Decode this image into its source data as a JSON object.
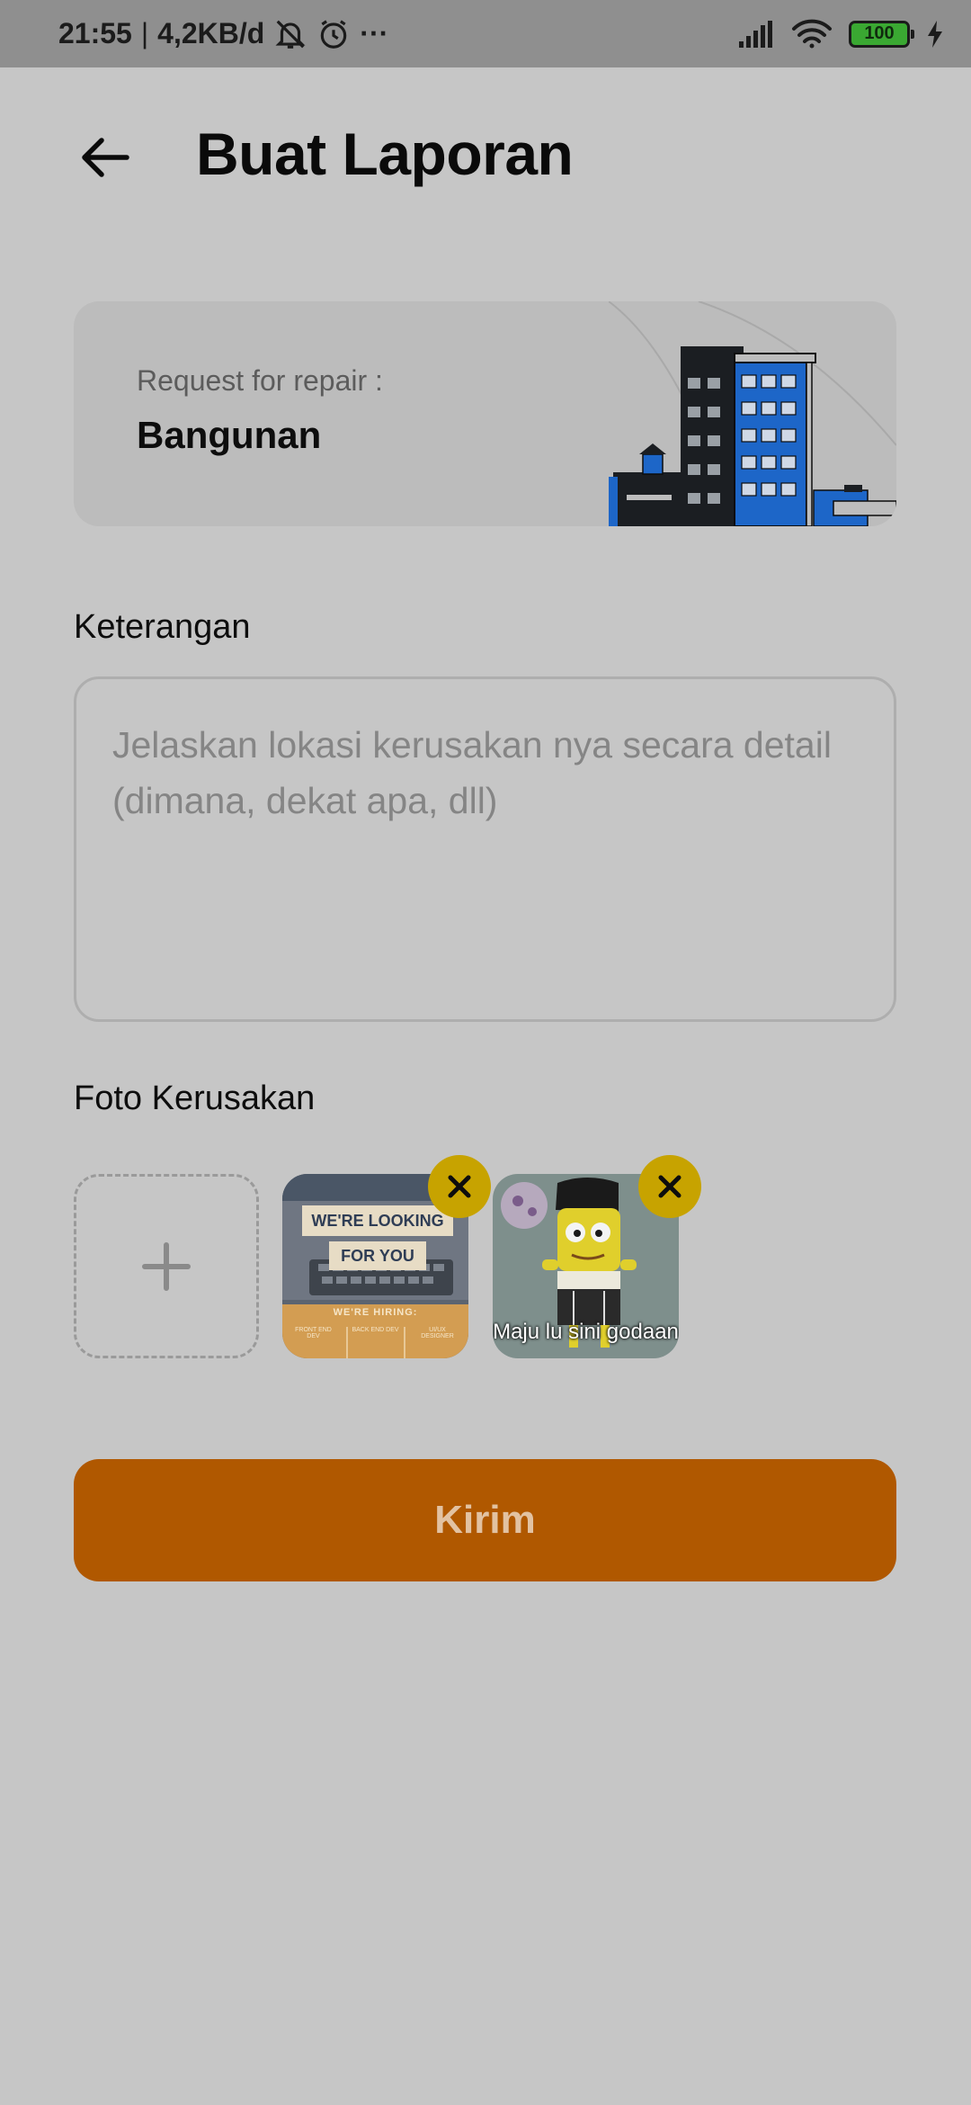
{
  "status_bar": {
    "time": "21:55",
    "speed": "4,2KB/d",
    "more": "···",
    "battery": "100"
  },
  "header": {
    "title": "Buat Laporan"
  },
  "category_card": {
    "subtitle": "Request for repair :",
    "title": "Bangunan"
  },
  "description": {
    "label": "Keterangan",
    "placeholder": "Jelaskan lokasi kerusakan nya secara detail (dimana, dekat apa, dll)",
    "value": ""
  },
  "photos": {
    "label": "Foto Kerusakan",
    "items": [
      {
        "banner_line1": "WE'RE LOOKING",
        "banner_line2": "FOR YOU",
        "footer": "WE'RE HIRING:",
        "roles": [
          "FRONT END DEV",
          "BACK END DEV",
          "UI/UX DESIGNER"
        ]
      },
      {
        "caption": "Maju lu sini godaan"
      }
    ]
  },
  "submit": {
    "label": "Kirim"
  },
  "colors": {
    "background": "#c6c6c6",
    "accent": "#b05800",
    "remove_badge": "#c7a300",
    "battery": "#3aa832"
  }
}
